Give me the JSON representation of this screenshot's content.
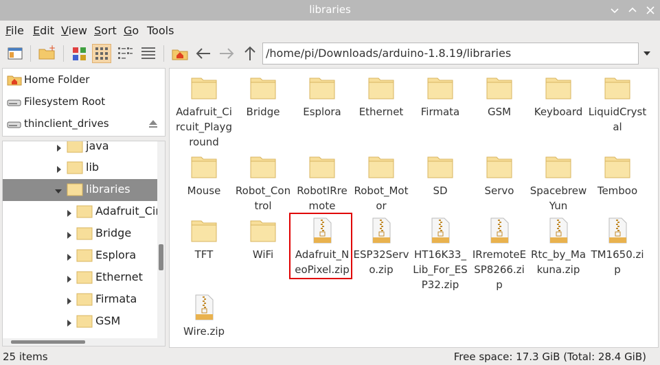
{
  "window": {
    "title": "libraries"
  },
  "menu": [
    {
      "key": "F",
      "rest": "ile"
    },
    {
      "key": "E",
      "rest": "dit"
    },
    {
      "key": "V",
      "rest": "iew"
    },
    {
      "key": "S",
      "rest": "ort"
    },
    {
      "key": "G",
      "rest": "o"
    },
    {
      "key": "",
      "rest": "Tools"
    }
  ],
  "path": {
    "value": "/home/pi/Downloads/arduino-1.8.19/libraries"
  },
  "places": [
    {
      "label": "Home Folder",
      "icon": "home-folder-icon"
    },
    {
      "label": "Filesystem Root",
      "icon": "drive-icon"
    },
    {
      "label": "thinclient_drives",
      "icon": "drive-icon"
    }
  ],
  "tree": [
    {
      "label": "java",
      "expanded": false,
      "selected": false,
      "level": 0
    },
    {
      "label": "lib",
      "expanded": false,
      "selected": false,
      "level": 0
    },
    {
      "label": "libraries",
      "expanded": true,
      "selected": true,
      "level": 0
    },
    {
      "label": "Adafruit_Circ",
      "expanded": false,
      "selected": false,
      "level": 1
    },
    {
      "label": "Bridge",
      "expanded": false,
      "selected": false,
      "level": 1
    },
    {
      "label": "Esplora",
      "expanded": false,
      "selected": false,
      "level": 1
    },
    {
      "label": "Ethernet",
      "expanded": false,
      "selected": false,
      "level": 1
    },
    {
      "label": "Firmata",
      "expanded": false,
      "selected": false,
      "level": 1
    },
    {
      "label": "GSM",
      "expanded": false,
      "selected": false,
      "level": 1
    }
  ],
  "files": [
    {
      "name": "Adafruit_Circuit_Playground",
      "type": "folder",
      "lines": [
        "Adafruit_Ci",
        "rcuit_Playg",
        "round"
      ]
    },
    {
      "name": "Bridge",
      "type": "folder",
      "lines": [
        "Bridge"
      ]
    },
    {
      "name": "Esplora",
      "type": "folder",
      "lines": [
        "Esplora"
      ]
    },
    {
      "name": "Ethernet",
      "type": "folder",
      "lines": [
        "Ethernet"
      ]
    },
    {
      "name": "Firmata",
      "type": "folder",
      "lines": [
        "Firmata"
      ]
    },
    {
      "name": "GSM",
      "type": "folder",
      "lines": [
        "GSM"
      ]
    },
    {
      "name": "Keyboard",
      "type": "folder",
      "lines": [
        "Keyboard"
      ]
    },
    {
      "name": "LiquidCrystal",
      "type": "folder",
      "lines": [
        "LiquidCryst",
        "al"
      ]
    },
    {
      "name": "Mouse",
      "type": "folder",
      "lines": [
        "Mouse"
      ]
    },
    {
      "name": "Robot_Control",
      "type": "folder",
      "lines": [
        "Robot_Con",
        "trol"
      ]
    },
    {
      "name": "RobotIRremote",
      "type": "folder",
      "lines": [
        "RobotIRre",
        "mote"
      ]
    },
    {
      "name": "Robot_Motor",
      "type": "folder",
      "lines": [
        "Robot_Mot",
        "or"
      ]
    },
    {
      "name": "SD",
      "type": "folder",
      "lines": [
        "SD"
      ]
    },
    {
      "name": "Servo",
      "type": "folder",
      "lines": [
        "Servo"
      ]
    },
    {
      "name": "SpacebrewYun",
      "type": "folder",
      "lines": [
        "Spacebrew",
        "Yun"
      ]
    },
    {
      "name": "Temboo",
      "type": "folder",
      "lines": [
        "Temboo"
      ]
    },
    {
      "name": "TFT",
      "type": "folder",
      "lines": [
        "TFT"
      ]
    },
    {
      "name": "WiFi",
      "type": "folder",
      "lines": [
        "WiFi"
      ]
    },
    {
      "name": "Adafruit_NeoPixel.zip",
      "type": "zip",
      "lines": [
        "Adafruit_N",
        "eoPixel.zip"
      ]
    },
    {
      "name": "ESP32Servo.zip",
      "type": "zip",
      "lines": [
        "ESP32Serv",
        "o.zip"
      ]
    },
    {
      "name": "HT16K33_Lib_For_ESP32.zip",
      "type": "zip",
      "lines": [
        "HT16K33_",
        "Lib_For_ES",
        "P32.zip"
      ]
    },
    {
      "name": "IRremoteESP8266.zip",
      "type": "zip",
      "lines": [
        "IRremoteE",
        "SP8266.zi",
        "p"
      ]
    },
    {
      "name": "Rtc_by_Makuna.zip",
      "type": "zip",
      "lines": [
        "Rtc_by_Ma",
        "kuna.zip"
      ]
    },
    {
      "name": "TM1650.zip",
      "type": "zip",
      "lines": [
        "TM1650.zi",
        "p"
      ]
    },
    {
      "name": "Wire.zip",
      "type": "zip",
      "lines": [
        "Wire.zip"
      ]
    }
  ],
  "status": {
    "count": "25 items",
    "free": "Free space: 17.3 GiB (Total: 28.4 GiB)"
  },
  "colors": {
    "titlebar": "#b9b9b9",
    "folder": "#f7de9a",
    "selection": "#8c8c8c",
    "highlight": "#e00000"
  }
}
